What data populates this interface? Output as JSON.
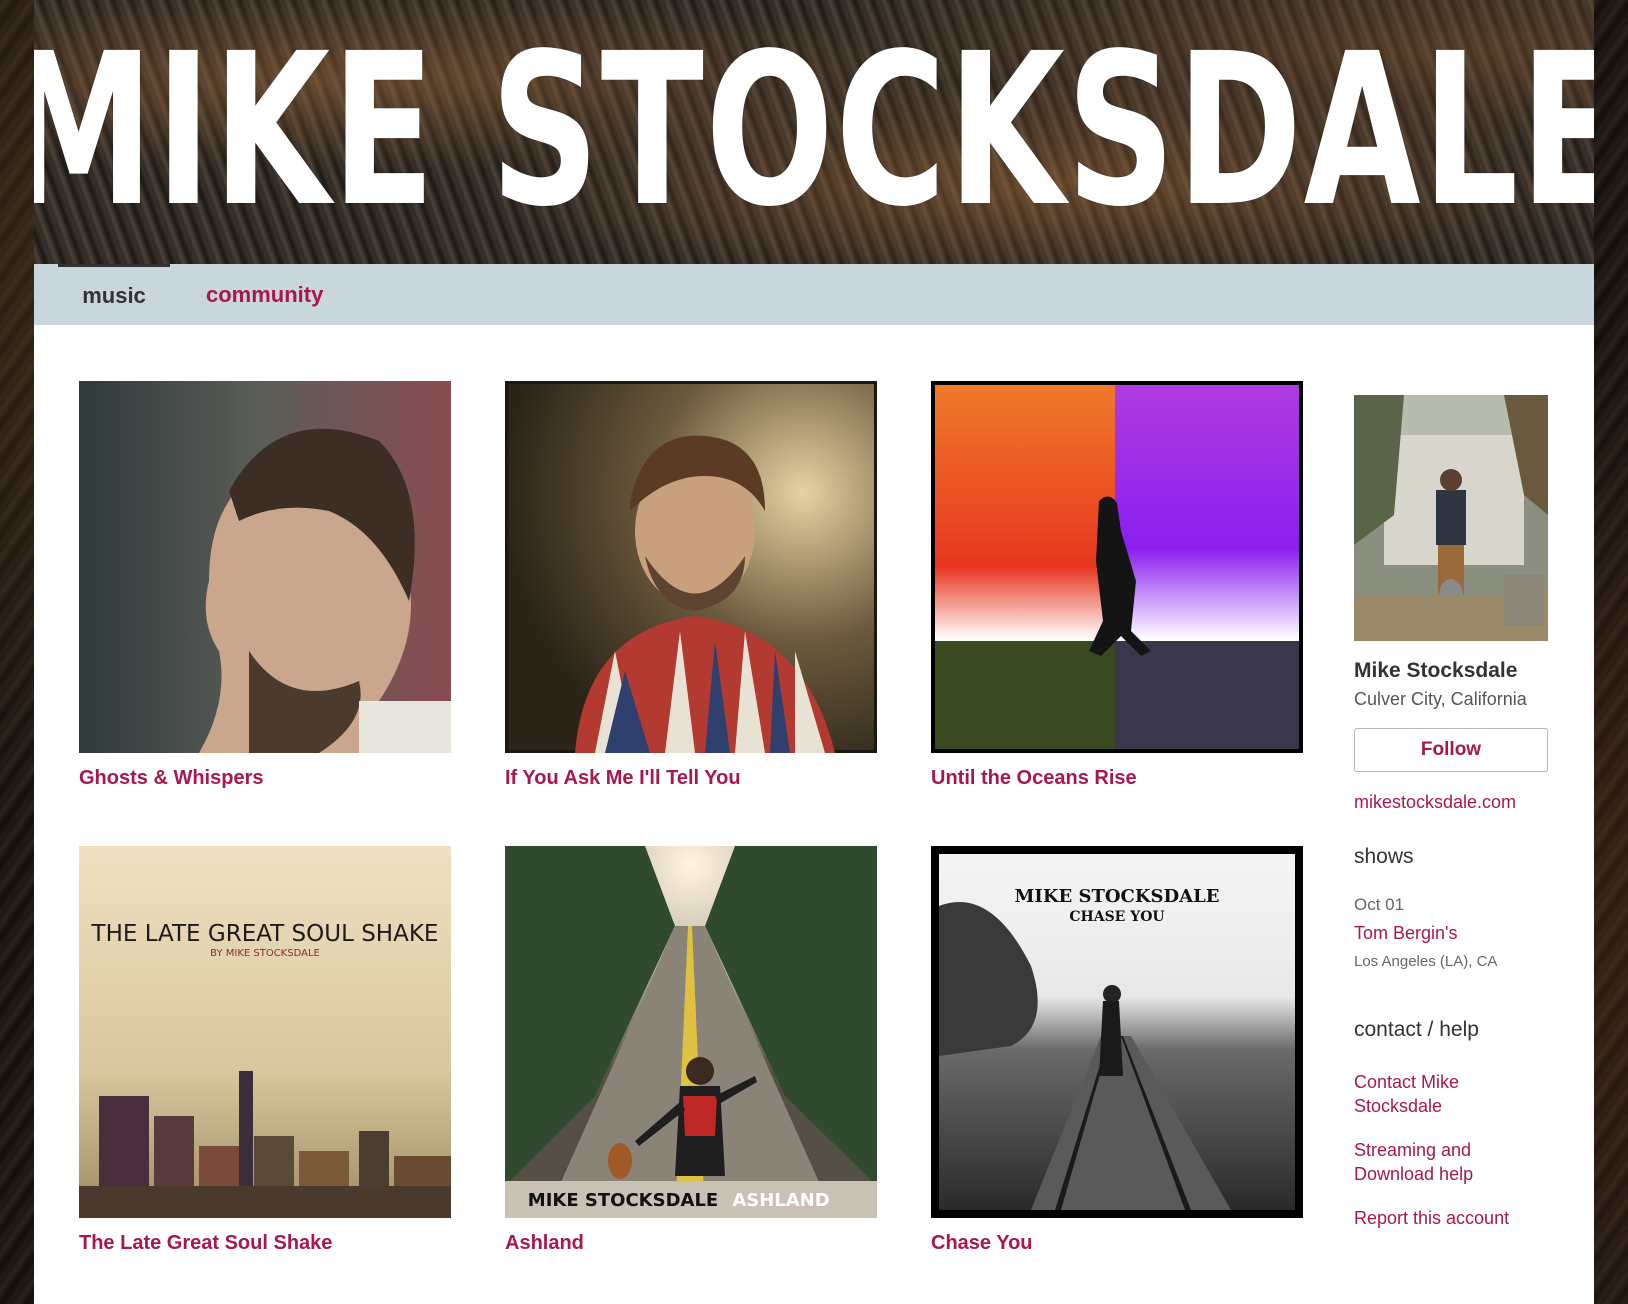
{
  "banner": {
    "title": "MIKE STOCKSDALE"
  },
  "nav": {
    "tabs": [
      {
        "label": "music"
      },
      {
        "label": "community"
      }
    ]
  },
  "albums": [
    {
      "title": "Ghosts & Whispers"
    },
    {
      "title": "If You Ask Me I'll Tell You"
    },
    {
      "title": "Until the Oceans Rise"
    },
    {
      "title": "The Late Great Soul Shake",
      "cover_text": "THE LATE GREAT SOUL SHAKE",
      "cover_subtext": "BY MIKE STOCKSDALE"
    },
    {
      "title": "Ashland",
      "cover_text": "MIKE STOCKSDALE",
      "cover_subtext": "ASHLAND"
    },
    {
      "title": "Chase You",
      "cover_text": "MIKE STOCKSDALE",
      "cover_subtext": "CHASE YOU"
    }
  ],
  "sidebar": {
    "artist_name": "Mike Stocksdale",
    "location": "Culver City, California",
    "follow_label": "Follow",
    "website": "mikestocksdale.com",
    "shows_heading": "shows",
    "shows": [
      {
        "date": "Oct 01",
        "venue": "Tom Bergin's",
        "location": "Los Angeles (LA), CA"
      }
    ],
    "help_heading": "contact / help",
    "help_links": [
      {
        "label": "Contact Mike Stocksdale"
      },
      {
        "label": "Streaming and Download help"
      },
      {
        "label": "Report this account"
      }
    ]
  },
  "colors": {
    "accent": "#a8174f",
    "nav_bg": "#c9d6dc",
    "text": "#333333"
  }
}
